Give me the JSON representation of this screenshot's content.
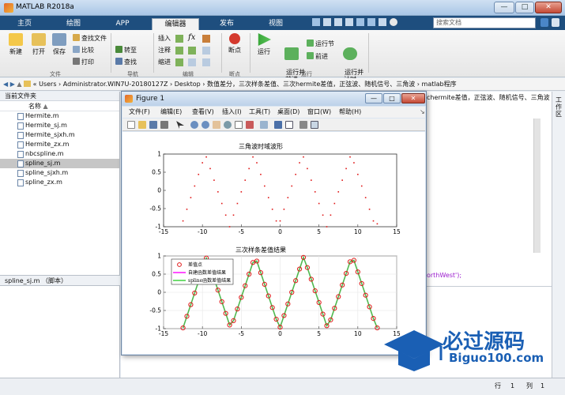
{
  "window": {
    "title": "MATLAB R2018a",
    "min": "—",
    "max": "□",
    "close": "✕"
  },
  "ribbon": {
    "tabs": [
      "主页",
      "绘图",
      "APP",
      "编辑器",
      "发布",
      "视图"
    ],
    "active_tab": 3,
    "search_placeholder": "搜索文档",
    "buttons": {
      "new": "新建",
      "open": "打开",
      "save": "保存",
      "find_files": "查找文件",
      "compare": "比较",
      "print": "打印",
      "goto": "转至",
      "find": "查找",
      "insert": "插入",
      "comment": "注释",
      "indent": "缩进",
      "fx": "fx",
      "breakpoint": "断点",
      "run": "运行",
      "run_advance": "运行并\n前进",
      "run_section": "运行节",
      "advance": "前进",
      "run_time": "运行并\n计时"
    },
    "groups": {
      "file": "文件",
      "navigate": "导航",
      "edit": "编辑",
      "breakpoints": "断点",
      "run": "运行"
    }
  },
  "address": {
    "path": [
      "Users",
      "Administrator.WIN7U-20180127Z",
      "Desktop",
      "数值差分，三次样条差值、三次hermite差值，正弦波、随机信号、三角波",
      "matlab程序"
    ]
  },
  "file_panel": {
    "header": "当前文件夹",
    "column": "名称",
    "files": [
      "Hermite.m",
      "Hermite_sj.m",
      "Hermite_sjxh.m",
      "Hermite_zx.m",
      "nbcspline.m",
      "spline_sj.m",
      "spline_sjxh.m",
      "spline_zx.m"
    ],
    "selected_index": 5,
    "details": "spline_sj.m （脚本）"
  },
  "editor": {
    "header_text": "chermite差值，正弦波、随机信号、三角波",
    "code_fragment": "orthWest');",
    "right_panel_label": "工作区"
  },
  "figure": {
    "title": "Figure 1",
    "min": "—",
    "max": "□",
    "close": "✕",
    "menu": [
      "文件(F)",
      "编辑(E)",
      "查看(V)",
      "插入(I)",
      "工具(T)",
      "桌面(D)",
      "窗口(W)",
      "帮助(H)"
    ]
  },
  "statusbar": {
    "row_label": "行",
    "row": "1",
    "col_label": "列",
    "col": "1"
  },
  "watermark": {
    "brand": "必过源码",
    "url": "Biguo100.com"
  },
  "colors": {
    "ribbon_dark": "#1e4e7e",
    "scatter": "#e01818",
    "circle": "#e01818",
    "hermite_line": "#ff00ff",
    "spline_line": "#33cc33",
    "sel_row": "#c6c6c6"
  },
  "chart_data": [
    {
      "type": "scatter",
      "title": "三角波时域波形",
      "xlim": [
        -15,
        15
      ],
      "ylim": [
        -1,
        1
      ],
      "xticks": [
        "-15",
        "-10",
        "-5",
        "0",
        "5",
        "10",
        "15"
      ],
      "yticks": [
        "-1",
        "-0.5",
        "0",
        "0.5",
        "1"
      ],
      "grid": false,
      "x": [
        -12.5,
        -12,
        -11.5,
        -11,
        -10.5,
        -10,
        -9.5,
        -9,
        -8.5,
        -8,
        -7.5,
        -7,
        -6.5,
        -6,
        -5.5,
        -5,
        -4.5,
        -4,
        -3.5,
        -3,
        -2.5,
        -2,
        -1.5,
        -1,
        -0.5,
        0,
        0.5,
        1,
        1.5,
        2,
        2.5,
        3,
        3.5,
        4,
        4.5,
        5,
        5.5,
        6,
        6.5,
        7,
        7.5,
        8,
        8.5,
        9,
        9.5,
        10,
        10.5,
        11,
        11.5,
        12,
        12.5
      ],
      "y": [
        -0.84,
        -0.52,
        -0.2,
        0.12,
        0.44,
        0.76,
        0.92,
        0.6,
        0.28,
        -0.04,
        -0.36,
        -0.68,
        -1.0,
        -0.68,
        -0.36,
        -0.04,
        0.28,
        0.6,
        0.92,
        0.76,
        0.44,
        0.12,
        -0.2,
        -0.52,
        -0.84,
        -0.84,
        -0.52,
        -0.2,
        0.12,
        0.44,
        0.76,
        0.92,
        0.6,
        0.28,
        -0.04,
        -0.36,
        -0.68,
        -1.0,
        -0.68,
        -0.36,
        -0.04,
        0.28,
        0.6,
        0.92,
        0.76,
        0.44,
        0.12,
        -0.2,
        -0.52,
        -0.84,
        -0.92
      ]
    },
    {
      "type": "line",
      "title": "三次样条差值结果",
      "xlim": [
        -15,
        15
      ],
      "ylim": [
        -1,
        1
      ],
      "xticks": [
        "-15",
        "-10",
        "-5",
        "0",
        "5",
        "10",
        "15"
      ],
      "yticks": [
        "-1",
        "-0.5",
        "0",
        "0.5",
        "1"
      ],
      "grid": true,
      "legend": [
        "差值点",
        "自建函数差值结果",
        "spline函数差值结果"
      ],
      "legend_position": "top-left",
      "x": [
        -12.5,
        -12,
        -11.5,
        -11,
        -10.5,
        -10,
        -9.5,
        -9,
        -8.5,
        -8,
        -7.5,
        -7,
        -6.5,
        -6,
        -5.5,
        -5,
        -4.5,
        -4,
        -3.5,
        -3,
        -2.5,
        -2,
        -1.5,
        -1,
        -0.5,
        0,
        0.5,
        1,
        1.5,
        2,
        2.5,
        3,
        3.5,
        4,
        4.5,
        5,
        5.5,
        6,
        6.5,
        7,
        7.5,
        8,
        8.5,
        9,
        9.5,
        10,
        10.5,
        11,
        11.5,
        12,
        12.5
      ],
      "y": [
        -0.98,
        -0.66,
        -0.34,
        -0.02,
        0.3,
        0.62,
        0.94,
        0.7,
        0.38,
        0.06,
        -0.26,
        -0.58,
        -0.9,
        -0.78,
        -0.46,
        -0.14,
        0.18,
        0.5,
        0.82,
        0.86,
        0.54,
        0.22,
        -0.1,
        -0.42,
        -0.74,
        -0.96,
        -0.64,
        -0.32,
        0.0,
        0.32,
        0.64,
        0.96,
        0.68,
        0.36,
        0.04,
        -0.28,
        -0.6,
        -0.92,
        -0.76,
        -0.44,
        -0.12,
        0.2,
        0.52,
        0.84,
        0.88,
        0.56,
        0.24,
        -0.08,
        -0.4,
        -0.72,
        -0.98
      ]
    }
  ]
}
